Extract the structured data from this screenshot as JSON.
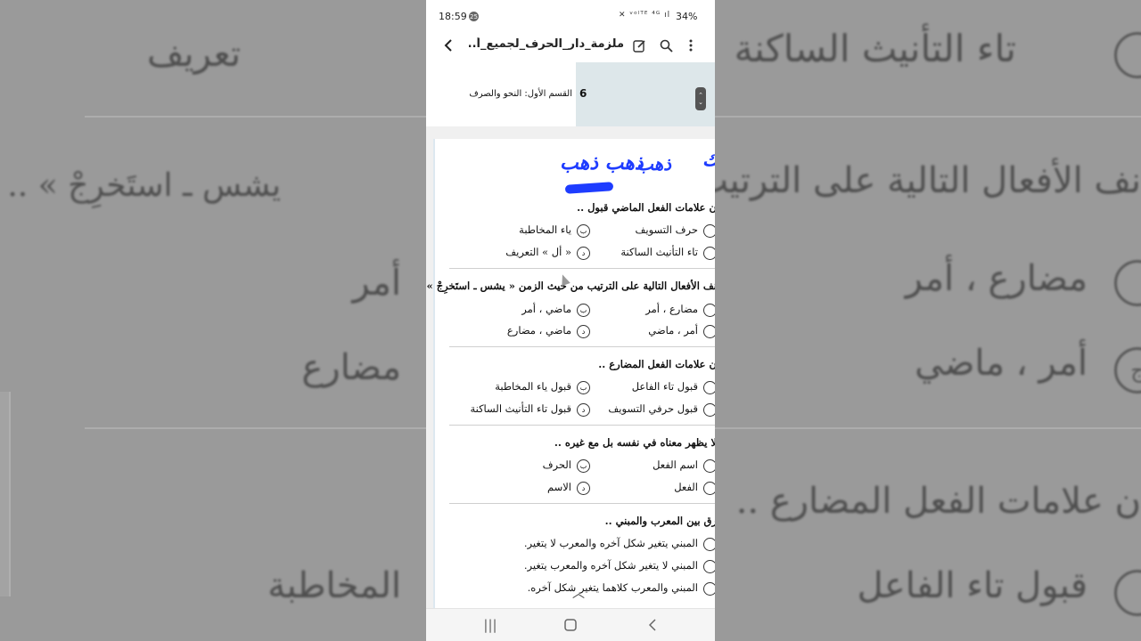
{
  "background": {
    "lines": [
      "تاء التأنيث الساكنة",
      "تعريف",
      "نف الأفعال التالية على الترتيب",
      "يشس ـ استَخرِجْ » ..",
      "مضارع ، أمر",
      "أمر",
      "أمر ، ماضي",
      "مضارع",
      "ن علامات الفعل المضارع ..",
      "قبول تاء الفاعل",
      "المخاطبة"
    ],
    "marks": [
      "ب",
      "ج",
      "أ"
    ]
  },
  "status_bar": {
    "time": "18:59",
    "badge": "25",
    "network_icons": "✕ ᵛᵒˡᵀᴱ ⁴ᴳ ıl",
    "battery": "34%"
  },
  "app_bar": {
    "title": "ملزمة_دار_الحرف_لجميع_أ...",
    "back_icon": "chevron-left",
    "edit_icon": "edit-note",
    "search_icon": "search",
    "more_icon": "more-vertical"
  },
  "page_header": {
    "title": "القسم الأول: النحو والصرف",
    "page_number": "6"
  },
  "ink_annotations": [
    "ذهب ذهب",
    "ذهب",
    "ك"
  ],
  "questions": [
    {
      "stem": "ن علامات الفعل الماضي قبول ..",
      "options": [
        {
          "mark": "",
          "text": "حرف التسويف"
        },
        {
          "mark": "ب",
          "text": "ياء المخاطبة"
        },
        {
          "mark": "",
          "text": "تاء التأنيث الساكنة"
        },
        {
          "mark": "د",
          "text": "« أل » التعريف"
        }
      ]
    },
    {
      "stem": "نف الأفعال التالية على الترتيب من حيث الزمن « يشس ـ استَخرِجْ » ..",
      "options": [
        {
          "mark": "",
          "text": "مضارع ، أمر"
        },
        {
          "mark": "ب",
          "text": "ماضي ، أمر"
        },
        {
          "mark": "",
          "text": "أمر ، ماضي"
        },
        {
          "mark": "د",
          "text": "ماضي ، مضارع"
        }
      ]
    },
    {
      "stem": "ن علامات الفعل المضارع ..",
      "options": [
        {
          "mark": "",
          "text": "قبول تاء الفاعل"
        },
        {
          "mark": "ب",
          "text": "قبول ياء المخاطبة"
        },
        {
          "mark": "",
          "text": "قبول حرفي التسويف"
        },
        {
          "mark": "د",
          "text": "قبول تاء التأنيث الساكنة"
        }
      ]
    },
    {
      "stem": "لا يظهر معناه في نفسه بل مع غيره ..",
      "options": [
        {
          "mark": "",
          "text": "اسم الفعل"
        },
        {
          "mark": "ب",
          "text": "الحرف"
        },
        {
          "mark": "",
          "text": "الفعل"
        },
        {
          "mark": "د",
          "text": "الاسم"
        }
      ]
    },
    {
      "stem": "رق بين المعرب والمبني ..",
      "options": [
        {
          "mark": "",
          "text": "المبني يتغير شكل آخره والمعرب لا يتغير."
        },
        {
          "mark": "",
          "text": "المبني لا يتغير شكل آخره والمعرب يتغير."
        },
        {
          "mark": "",
          "text": "المبني والمعرب كلاهما يتغير شكل آخره."
        }
      ]
    }
  ],
  "nav_bar": {
    "recents_icon": "|||",
    "home_icon": "○",
    "back_icon": "‹"
  }
}
